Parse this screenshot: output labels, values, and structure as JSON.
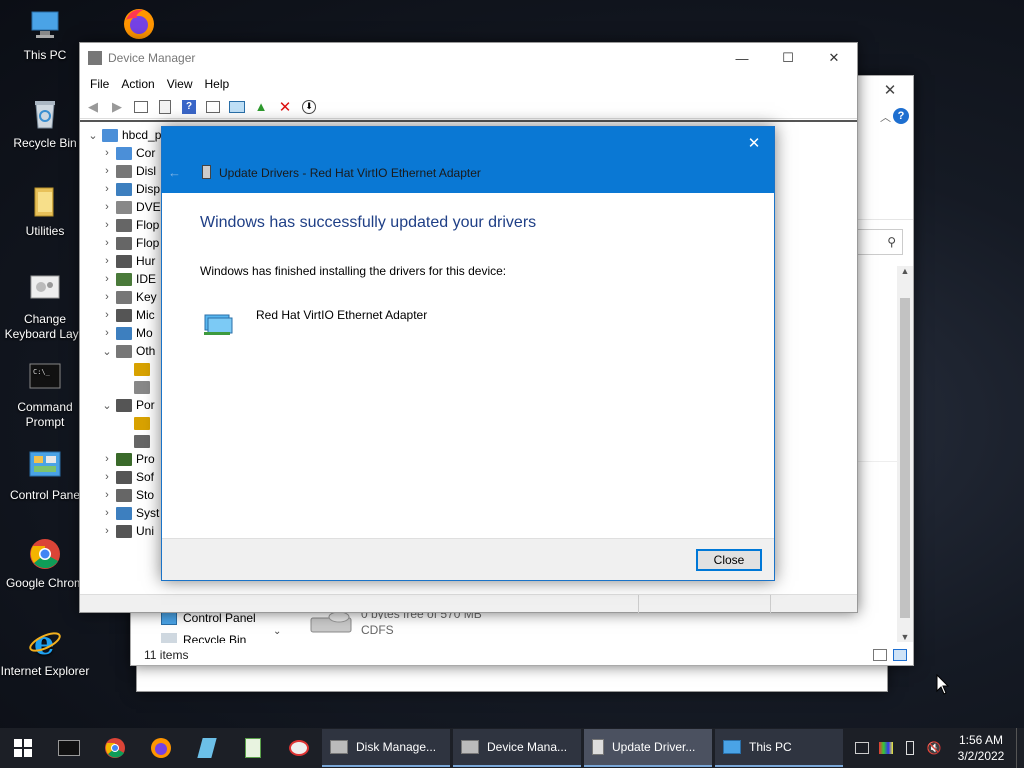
{
  "desktop": {
    "icons": [
      {
        "label": "This PC",
        "icon": "pc-icon"
      },
      {
        "label": "Firefox",
        "icon": "firefox-icon"
      },
      {
        "label": "Recycle Bin",
        "icon": "recycle-bin-icon"
      },
      {
        "label": "Utilities",
        "icon": "folder-icon"
      },
      {
        "label": "Change Keyboard Layo",
        "label2": "Change",
        "icon": "keyboard-icon"
      },
      {
        "label": "Command",
        "label2": "Prompt",
        "icon": "cmd-icon"
      },
      {
        "label": "Control Panel",
        "icon": "control-panel-icon"
      },
      {
        "label": "Google Chrome",
        "icon": "chrome-icon"
      },
      {
        "label": "Internet Explorer",
        "icon": "ie-icon"
      }
    ],
    "keyboard_label_1": "Change",
    "keyboard_label_2": "Keyboard Layo",
    "cmd_label_1": "Command",
    "cmd_label_2": "Prompt",
    "this_pc": "This PC",
    "recycle_bin": "Recycle Bin",
    "utilities": "Utilities",
    "control_panel": "Control Pane",
    "chrome": "Google Chrom",
    "ie": "Internet Explorer"
  },
  "explorer": {
    "sidebar_item_control_panel": "Control Panel",
    "sidebar_item_recycle_bin": "Recycle Bin",
    "drive_free": "0 bytes free of 570 MB",
    "drive_fs": "CDFS",
    "status_items": "11 items"
  },
  "device_manager": {
    "title": "Device Manager",
    "menu": [
      "File",
      "Action",
      "View",
      "Help"
    ],
    "root": "hbcd_p",
    "tree": [
      {
        "arrow": "›",
        "label": "Cor",
        "color": "#4b8fd8",
        "indent": 0
      },
      {
        "arrow": "›",
        "label": "Disl",
        "color": "#777",
        "indent": 0
      },
      {
        "arrow": "›",
        "label": "Disp",
        "color": "#3d7fbf",
        "indent": 0
      },
      {
        "arrow": "›",
        "label": "DVE",
        "color": "#888",
        "indent": 0
      },
      {
        "arrow": "›",
        "label": "Flop",
        "color": "#666",
        "indent": 0
      },
      {
        "arrow": "›",
        "label": "Flop",
        "color": "#666",
        "indent": 0
      },
      {
        "arrow": "›",
        "label": "Hur",
        "color": "#555",
        "indent": 0
      },
      {
        "arrow": "›",
        "label": "IDE",
        "color": "#4a7a3a",
        "indent": 0
      },
      {
        "arrow": "›",
        "label": "Key",
        "color": "#777",
        "indent": 0
      },
      {
        "arrow": "›",
        "label": "Mic",
        "color": "#555",
        "indent": 0
      },
      {
        "arrow": "›",
        "label": "Mo",
        "color": "#3d7fbf",
        "indent": 0
      },
      {
        "arrow": "⌄",
        "label": "Oth",
        "color": "#777",
        "indent": 0
      },
      {
        "arrow": "",
        "label": "",
        "color": "#d8a200",
        "indent": 1
      },
      {
        "arrow": "",
        "label": "",
        "color": "#888",
        "indent": 1
      },
      {
        "arrow": "⌄",
        "label": "Por",
        "color": "#555",
        "indent": 0
      },
      {
        "arrow": "",
        "label": "",
        "color": "#d8a200",
        "indent": 1
      },
      {
        "arrow": "",
        "label": "",
        "color": "#666",
        "indent": 1
      },
      {
        "arrow": "›",
        "label": "Pro",
        "color": "#3a6a2a",
        "indent": 0
      },
      {
        "arrow": "›",
        "label": "Sof",
        "color": "#555",
        "indent": 0
      },
      {
        "arrow": "›",
        "label": "Sto",
        "color": "#666",
        "indent": 0
      },
      {
        "arrow": "›",
        "label": "Syst",
        "color": "#3d7fbf",
        "indent": 0
      },
      {
        "arrow": "›",
        "label": "Uni",
        "color": "#555",
        "indent": 0
      }
    ]
  },
  "dialog": {
    "title": "Update Drivers - Red Hat VirtIO Ethernet Adapter",
    "heading": "Windows has successfully updated your drivers",
    "message": "Windows has finished installing the drivers for this device:",
    "device_name": "Red Hat VirtIO Ethernet Adapter",
    "close_label": "Close"
  },
  "taskbar": {
    "tasks": [
      {
        "label": "Disk Manage...",
        "icon": "disk-management-icon"
      },
      {
        "label": "Device Mana...",
        "icon": "device-manager-icon"
      },
      {
        "label": "Update Driver...",
        "icon": "update-driver-icon"
      },
      {
        "label": "This PC",
        "icon": "this-pc-icon"
      }
    ],
    "time": "1:56 AM",
    "date": "3/2/2022"
  }
}
